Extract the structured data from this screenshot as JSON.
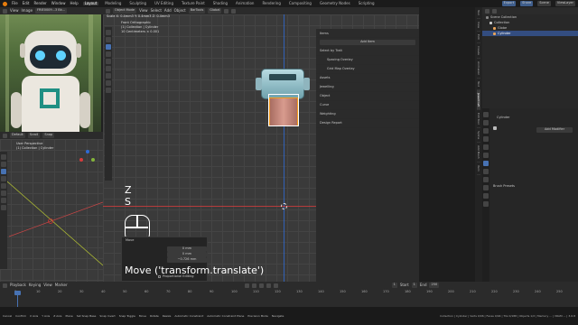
{
  "topbar": {
    "menus": [
      "File",
      "Edit",
      "Render",
      "Window",
      "Help"
    ],
    "workspace_tabs": [
      "Layout",
      "Modeling",
      "Sculpting",
      "UV Editing",
      "Texture Paint",
      "Shading",
      "Animation",
      "Rendering",
      "Compositing",
      "Geometry Nodes",
      "Scripting"
    ],
    "active_tab": "Layout",
    "right": {
      "export": "Export",
      "share": "Share",
      "scene": "Scene",
      "view_layer": "ViewLayer"
    }
  },
  "image_editor": {
    "header": {
      "view": "View",
      "image": "Image",
      "filename": "FRIE0009...3 Bk..."
    }
  },
  "main_viewport": {
    "header": {
      "mode": "Object Mode",
      "view": "View",
      "select": "Select",
      "add": "Add",
      "object": "Object",
      "global": "Global",
      "tool": "BarTools"
    },
    "scale_text": "Scale X: 0.4mm3  Y: 0.4mm3  Z: 0.4mm3",
    "overlay_lines": [
      "Front Orthographic",
      "(1) Collection | Cylinder",
      "10 Centimeters × 0.001"
    ],
    "key_overlay": {
      "key1": "Z",
      "key2": "S"
    },
    "redo_panel": {
      "title": "Move",
      "values": [
        "0 mm",
        "0 mm",
        "−0.726 mm"
      ],
      "checkbox": "Proportional Editing"
    },
    "operator_caption": "Move ('transform.translate')",
    "npanel": {
      "top_label": "Items",
      "button": "Add Item",
      "select_label": "Select by Trait",
      "rows": [
        "Spacing Overlay",
        "Grid Map Overlay"
      ],
      "sections": [
        "Assets",
        "Jewelling",
        "Object",
        "Curve",
        "Weighting",
        "Design Report"
      ]
    }
  },
  "side_viewport": {
    "header": {
      "orientation": "Default",
      "view": "Scroll",
      "snap": "Snap"
    },
    "overlay_lines": [
      "User Perspective",
      "(1) Collection | Cylinder"
    ]
  },
  "outliner": {
    "header": "Scene Collection",
    "rows": [
      {
        "label": "Collection",
        "active": false
      },
      {
        "label": "Globe",
        "active": false
      },
      {
        "label": "Cylinder",
        "active": true
      }
    ]
  },
  "properties": {
    "object_name": "Cylinder",
    "add_modifier": "Add Modifier",
    "section": "Brush Presets"
  },
  "right_vtabs": [
    "Tool",
    "View",
    "Edit",
    "Create",
    "Animation",
    "Text",
    "JewelCraft",
    "Edit Tool",
    "Spline",
    "Add Mesh",
    "Item"
  ],
  "timeline": {
    "menus": [
      "Playback",
      "Keying",
      "View",
      "Marker"
    ],
    "start_label": "Start",
    "start": "1",
    "end_label": "End",
    "end": "250",
    "current": "1",
    "ticks": [
      "0",
      "10",
      "20",
      "30",
      "40",
      "50",
      "60",
      "70",
      "80",
      "90",
      "100",
      "110",
      "120",
      "130",
      "140",
      "150",
      "160",
      "170",
      "180",
      "190",
      "200",
      "210",
      "220",
      "230",
      "240",
      "250"
    ]
  },
  "statusbar": {
    "items": [
      "Cancel",
      "Confirm",
      "X Axis",
      "Y Axis",
      "Z Axis",
      "Plane",
      "Set Snap Base",
      "Snap Invert",
      "Snap Toggle",
      "Move",
      "Rotate",
      "Resize",
      "Automatic Constraint",
      "Automatic Constraint Plane",
      "Precision Mode",
      "Navigate"
    ],
    "info": "Collection | Cylinder | Verts 0/96 | Faces 0/94 | Tris 0/188 | Objects 1/2 | Memory ... | VRAM ... | 3.6.8"
  },
  "colors": {
    "accent": "#4772b3",
    "x_axis": "#d63c3c",
    "y_axis": "#84b33b",
    "z_axis": "#2f6bd6",
    "selection": "#f59b1b"
  }
}
